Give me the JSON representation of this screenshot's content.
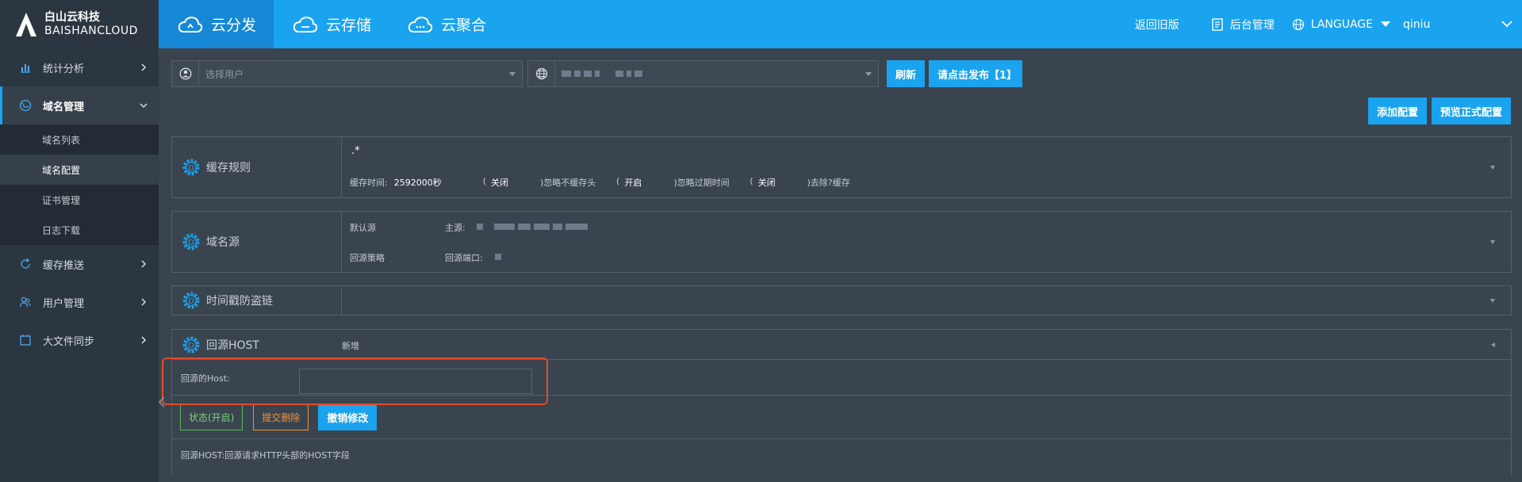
{
  "brand": {
    "cn": "白山云科技",
    "en": "BAISHANCLOUD"
  },
  "top_tabs": [
    {
      "label": "云分发",
      "active": true
    },
    {
      "label": "云存储",
      "active": false
    },
    {
      "label": "云聚合",
      "active": false
    }
  ],
  "top_right": {
    "old_version": "返回旧版",
    "admin": "后台管理",
    "language": "LANGUAGE",
    "user": "qiniu"
  },
  "sidebar": {
    "items": [
      {
        "label": "统计分析",
        "icon": "bar-chart-icon"
      },
      {
        "label": "域名管理",
        "icon": "globe-icon",
        "expanded": true
      },
      {
        "label": "缓存推送",
        "icon": "refresh-icon"
      },
      {
        "label": "用户管理",
        "icon": "users-icon"
      },
      {
        "label": "大文件同步",
        "icon": "calendar-icon"
      }
    ],
    "subitems": [
      {
        "label": "域名列表",
        "active": false
      },
      {
        "label": "域名配置",
        "active": true
      },
      {
        "label": "证书管理",
        "active": false
      },
      {
        "label": "日志下载",
        "active": false
      }
    ]
  },
  "filters": {
    "user_placeholder": "选择用户",
    "refresh": "刷新",
    "publish": "请点击发布【1】"
  },
  "actions": {
    "add_config": "添加配置",
    "preview_config": "预览正式配置"
  },
  "panels": {
    "cache": {
      "title": "缓存规则",
      "pattern": ".*",
      "time_label": "缓存时间:",
      "time_value": "2592000秒",
      "opt1": "关闭",
      "opt1_suffix": ")忽略不缓存头",
      "opt2": "开启",
      "opt2_suffix": ")忽略过期时间",
      "opt3": "关闭",
      "opt3_suffix": ")去除?缓存"
    },
    "origin": {
      "title": "域名源",
      "default_label": "默认源",
      "main_label": "主源:",
      "strategy_label": "回源策略",
      "port_label": "回源端口:"
    },
    "timestamp": {
      "title": "时间戳防盗链"
    },
    "host": {
      "title": "回源HOST",
      "new_label": "新增",
      "field_label": "回源的Host:",
      "status_btn": "状态(开启)",
      "delete_btn": "提交删除",
      "undo_btn": "撤销修改",
      "note": "回源HOST:回源请求HTTP头部的HOST字段"
    }
  },
  "colors": {
    "accent": "#1aa3ef",
    "sidebar": "#2c3640",
    "body": "#3a444e",
    "status_green": "#5cb85c",
    "delete_orange": "#f0923a",
    "highlight_red": "#e24b2e"
  }
}
